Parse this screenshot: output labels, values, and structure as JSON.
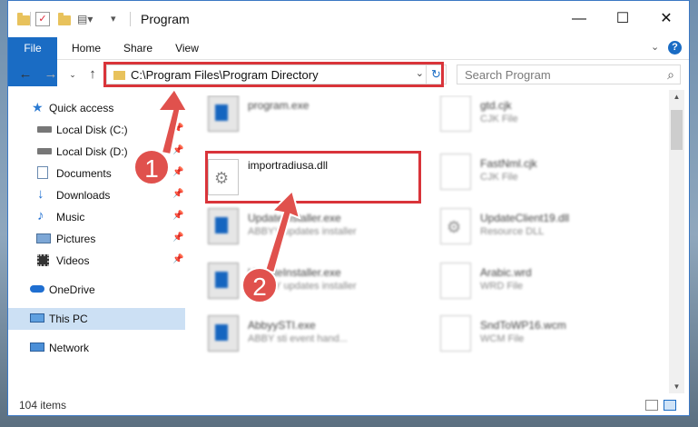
{
  "window": {
    "title": "Program",
    "controls": {
      "minimize": "—",
      "maximize": "☐",
      "close": "✕"
    }
  },
  "ribbon": {
    "tabs": [
      {
        "label": "File",
        "active": true
      },
      {
        "label": "Home"
      },
      {
        "label": "Share"
      },
      {
        "label": "View"
      }
    ],
    "expand_icon": "chevron-down-icon",
    "help_icon": "help-icon"
  },
  "address": {
    "path": "C:\\Program Files\\Program Directory",
    "dropdown_glyph": "⌄",
    "refresh_glyph": "↻"
  },
  "search": {
    "placeholder": "Search Program"
  },
  "nav_pane": {
    "items": [
      {
        "label": "Quick access",
        "icon": "star-icon",
        "pinned": false
      },
      {
        "label": "Local Disk (C:)",
        "icon": "drive-icon",
        "pinned": true
      },
      {
        "label": "Local Disk (D:)",
        "icon": "drive-icon",
        "pinned": true
      },
      {
        "label": "Documents",
        "icon": "documents-icon",
        "pinned": true
      },
      {
        "label": "Downloads",
        "icon": "downloads-icon",
        "pinned": true
      },
      {
        "label": "Music",
        "icon": "music-icon",
        "pinned": true
      },
      {
        "label": "Pictures",
        "icon": "pictures-icon",
        "pinned": true
      },
      {
        "label": "Videos",
        "icon": "videos-icon",
        "pinned": true
      },
      {
        "label": "OneDrive",
        "icon": "onedrive-icon",
        "pinned": false
      },
      {
        "label": "This PC",
        "icon": "this-pc-icon",
        "pinned": false,
        "selected": true
      },
      {
        "label": "Network",
        "icon": "network-icon",
        "pinned": false
      }
    ]
  },
  "files": [
    {
      "name": "program.exe",
      "desc": "",
      "icon": "exe"
    },
    {
      "name": "gtd.cjk",
      "desc": "CJK File",
      "icon": "doc"
    },
    {
      "name": "importradiusa.dll",
      "desc": "",
      "icon": "gear",
      "highlighted": true
    },
    {
      "name": "FastNml.cjk",
      "desc": "CJK File",
      "icon": "doc"
    },
    {
      "name": "UpdateInstaller.exe",
      "desc": "ABBYY updates installer",
      "icon": "exe"
    },
    {
      "name": "UpdateClient19.dll",
      "desc": "Resource DLL",
      "icon": "gear"
    },
    {
      "name": "UpdateInstaller.exe",
      "desc": "ABBYY updates installer",
      "icon": "exe"
    },
    {
      "name": "Arabic.wrd",
      "desc": "WRD File",
      "icon": "doc"
    },
    {
      "name": "AbbyySTI.exe",
      "desc": "ABBY sti event hand...",
      "icon": "exe"
    },
    {
      "name": "SndToWP16.wcm",
      "desc": "WCM File",
      "icon": "doc"
    }
  ],
  "status": {
    "count": "104 items"
  },
  "annotations": {
    "badge_1": "1",
    "badge_2": "2",
    "color": "#d9343a"
  }
}
